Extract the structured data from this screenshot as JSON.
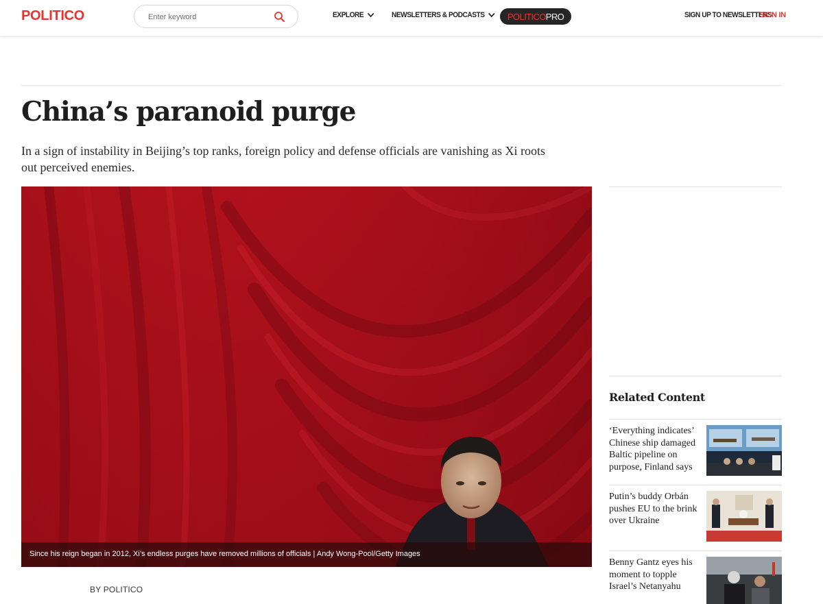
{
  "header": {
    "logo": "POLITICO",
    "search_placeholder": "Enter keyword",
    "nav": [
      {
        "label": "EXPLORE"
      },
      {
        "label": "NEWSLETTERS & PODCASTS"
      }
    ],
    "pro_part1": "POLITICO",
    "pro_part2": "PRO",
    "signup_label": "SIGN UP TO NEWSLETTERS",
    "signin_label": "SIGN IN"
  },
  "article": {
    "headline": "China’s paranoid purge",
    "dek": "In a sign of instability in Beijing’s top ranks, foreign policy and defense officials are vanishing as Xi roots out perceived enemies.",
    "image_caption": "Since his reign began in 2012, Xi’s endless purges have removed millions of officials | Andy Wong-Pool/Getty Images",
    "byline": "BY POLITICO"
  },
  "sidebar": {
    "related_title": "Related Content",
    "items": [
      {
        "headline": "‘Everything indicates’ Chinese ship damaged Baltic pipeline on purpose, Finland says"
      },
      {
        "headline": "Putin’s buddy Orbán pushes EU to the brink over Ukraine"
      },
      {
        "headline": "Benny Gantz eyes his moment to topple Israel’s Netanyahu"
      }
    ]
  },
  "colors": {
    "brand_red": "#e8332f",
    "pro_pill_bg": "#262626",
    "curtain_red": "#a8101a"
  },
  "icons": {
    "search": "search-icon",
    "chevron": "chevron-down-icon"
  }
}
